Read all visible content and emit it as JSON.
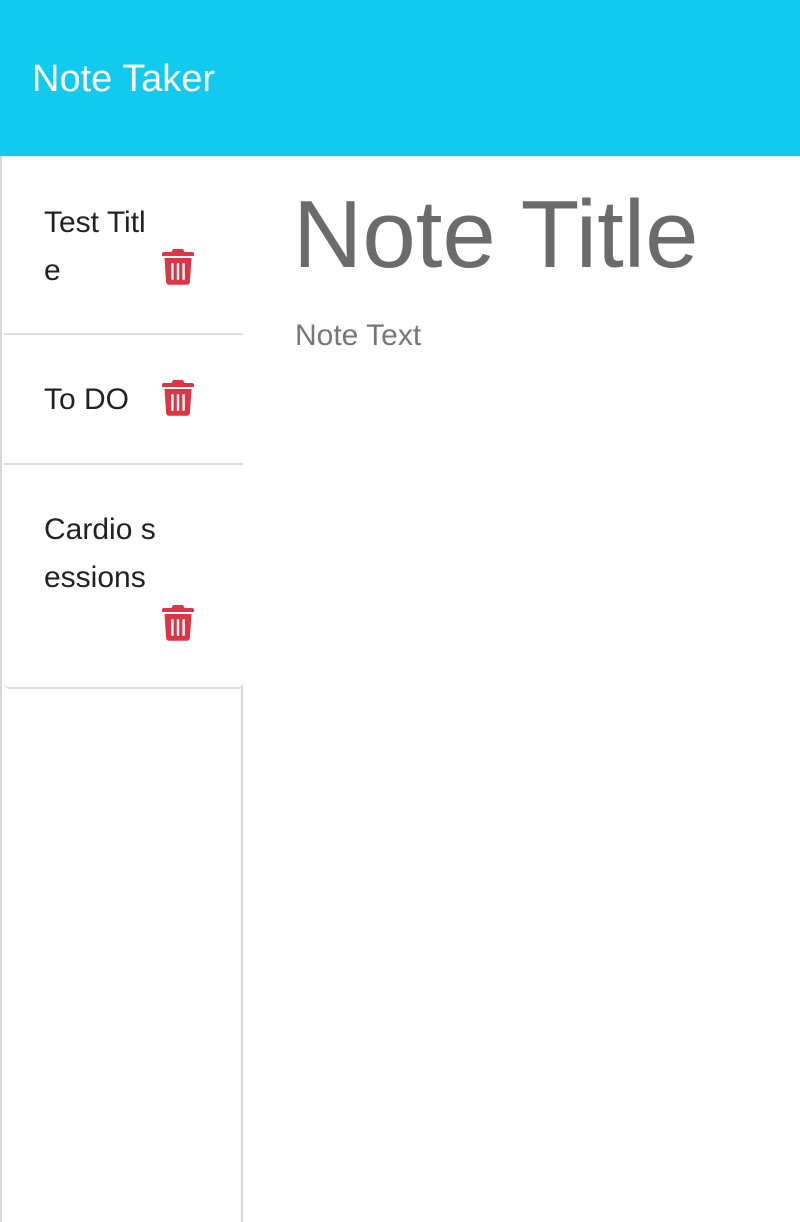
{
  "app": {
    "brand": "Note Taker",
    "header_color": "#12caed"
  },
  "notes": [
    {
      "title": "Test Title",
      "delete_icon": "trash-icon"
    },
    {
      "title": "To DO",
      "delete_icon": "trash-icon"
    },
    {
      "title": "Cardio sessions",
      "delete_icon": "trash-icon"
    }
  ],
  "editor": {
    "title_placeholder": "Note Title",
    "title_value": "",
    "text_placeholder": "Note Text",
    "text_value": ""
  },
  "colors": {
    "delete_red": "#dc3545",
    "placeholder_gray": "#6b6b6b"
  }
}
